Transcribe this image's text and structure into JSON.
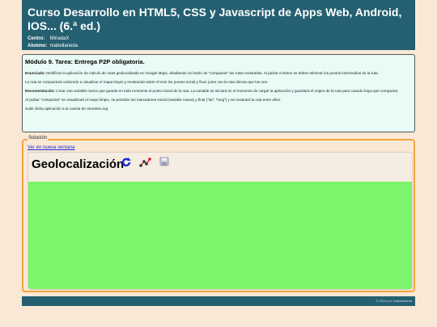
{
  "header": {
    "title": "Curso Desarrollo en HTML5, CSS y Javascript de Apps Web, Android, IOS... (6.ª ed.)",
    "centro_label": "Centro:",
    "centro_value": "MiriadaX",
    "alumno_label": "Alumno:",
    "alumno_value": "mabellaneda"
  },
  "task": {
    "title": "Módulo 9. Tarea: Entrega P2P obligatoria.",
    "enunciado_label": "Enunciado:",
    "enunciado_text": "Modificar la aplicación de calculo de rutas geolocalizada en Google Maps, añadiendo un botón de \"compactar\" las rutas mostradas. Al pulsar el boton se deben eliminar los puntos intermedios de la ruta.",
    "p2": "La ruta se compactará volviendo a visualizar el mapa limpio y mostrando sobre él solo los puntos inicial y final, junto con la ruta directa que los une.",
    "recomendacion_label": "Recomendación:",
    "recomendacion_text": "Crear una variable nueva que guarde en todo momento el punto inicial de la ruta. La variable se iniciará en el momento de cargar la aplicación y guardará el origen de la ruta para cuando haya que compactar.",
    "p4": "Al pulsar \"compactar\" se visualizará el mapa limpio, se pondrán los marcadores inicial (variable nueva) y final (\"lat\", \"long\") y se mostrará la ruta entre ellos.",
    "p5_prefix": "Subir dicha aplicación a la cuenta de ",
    "p5_link": "neocities.org."
  },
  "solution": {
    "legend": "Solución",
    "new_window_link": "Ver en nueva ventana",
    "app_title": "Geolocalización",
    "icons": [
      "refresh-icon",
      "route-icon",
      "save-icon"
    ],
    "map_color": "#7cf46c"
  },
  "footer": {
    "text": "© 2014 por 'mabellaneda"
  }
}
